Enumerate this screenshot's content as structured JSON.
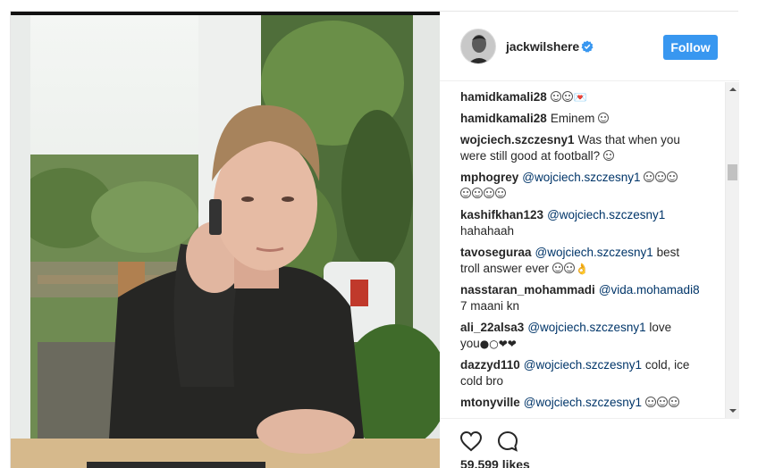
{
  "post": {
    "username": "jackwilshere",
    "follow_label": "Follow",
    "likes_text": "59,599 likes"
  },
  "comments": [
    {
      "user": "hamidkamali28",
      "pre": "",
      "mention": "",
      "text": "",
      "emoji_count": 2,
      "extra": "💌"
    },
    {
      "user": "hamidkamali28",
      "pre": "Eminem ",
      "mention": "",
      "text": "",
      "emoji_count": 1,
      "extra": ""
    },
    {
      "user": "wojciech.szczesny1",
      "pre": "Was that when you were still good at football? ",
      "mention": "",
      "text": "",
      "emoji_count": 1,
      "extra": ""
    },
    {
      "user": "mphogrey",
      "pre": "",
      "mention": "@wojciech.szczesny1",
      "text": " ",
      "emoji_count": 7,
      "extra": ""
    },
    {
      "user": "kashifkhan123",
      "pre": "",
      "mention": "@wojciech.szczesny1",
      "text": " hahahaah",
      "emoji_count": 0,
      "extra": ""
    },
    {
      "user": "tavoseguraa",
      "pre": "",
      "mention": "@wojciech.szczesny1",
      "text": " best troll answer ever ",
      "emoji_count": 2,
      "extra": "👌"
    },
    {
      "user": "nasstaran_mohammadi",
      "pre": "",
      "mention": "@vida.mohamadi8",
      "text": " 7 maani kn",
      "emoji_count": 0,
      "extra": ""
    },
    {
      "user": "ali_22alsa3",
      "pre": "",
      "mention": "@wojciech.szczesny1",
      "text": " love you",
      "emoji_count": 0,
      "extra": "●○❤❤"
    },
    {
      "user": "dazzyd110",
      "pre": "",
      "mention": "@wojciech.szczesny1",
      "text": " cold, ice cold bro",
      "emoji_count": 0,
      "extra": ""
    },
    {
      "user": "mtonyville",
      "pre": "",
      "mention": "@wojciech.szczesny1",
      "text": " ",
      "emoji_count": 3,
      "extra": ""
    }
  ],
  "icons": {
    "verified": "verified-badge-icon",
    "like": "heart-icon",
    "comment": "comment-bubble-icon"
  },
  "colors": {
    "follow_button": "#3897f0",
    "verified": "#3897f0",
    "mention": "#003569"
  }
}
